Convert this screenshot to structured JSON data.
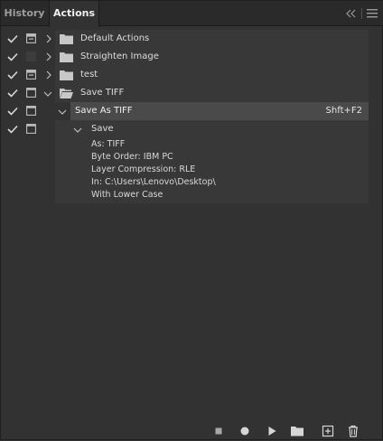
{
  "tabs": {
    "history": "History",
    "actions": "Actions"
  },
  "actions": {
    "sets": [
      {
        "label": "Default Actions"
      },
      {
        "label": "Straighten Image"
      },
      {
        "label": "test"
      },
      {
        "label": "Save TIFF"
      }
    ],
    "action": {
      "label": "Save As TIFF",
      "shortcut": "Shft+F2"
    },
    "step": {
      "label": "Save",
      "details": [
        "As: TIFF",
        "Byte Order: IBM PC",
        "Layer Compression: RLE",
        "In: C:\\Users\\Lenovo\\Desktop\\",
        "With Lower Case"
      ]
    }
  },
  "toolbar": {
    "buttons": [
      "stop-icon",
      "record-icon",
      "play-icon",
      "folder-icon",
      "new-action-icon",
      "trash-icon"
    ]
  },
  "colors": {
    "panel_bg": "#323232",
    "selected_row": "#4a4a4a"
  }
}
